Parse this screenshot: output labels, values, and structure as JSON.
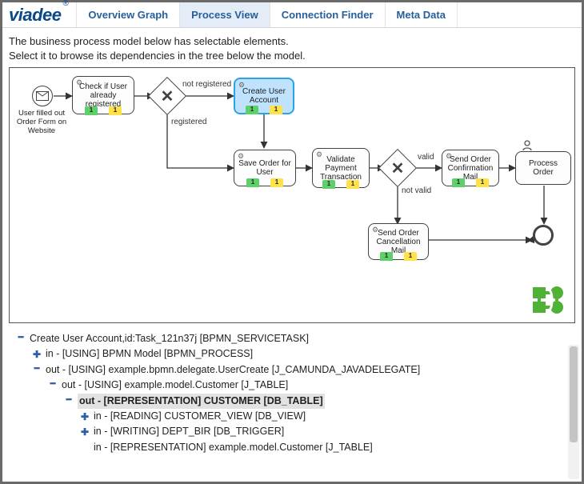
{
  "brand": "viadee",
  "brand_mark": "®",
  "tabs": {
    "overview": "Overview Graph",
    "process": "Process View",
    "connection": "Connection Finder",
    "meta": "Meta Data"
  },
  "instructions": {
    "line1": "The business process model below has selectable elements.",
    "line2": "Select it to browse its dependencies in the tree below the model."
  },
  "diagram": {
    "start_label": "User filled out Order Form on Website",
    "tasks": {
      "check_user": "Check if User already registered",
      "create_account": "Create User Account",
      "save_order": "Save Order for User",
      "validate": "Validate Payment Transaction",
      "send_conf": "Send Order Confirmation Mail",
      "send_cancel": "Send Order Cancellation Mail",
      "process_order": "Process Order"
    },
    "edge_labels": {
      "not_registered": "not registered",
      "registered": "registered",
      "valid": "valid",
      "not_valid": "not valid"
    },
    "badge": "1"
  },
  "tree": {
    "n0": "Create User Account,id:Task_121n37j [BPMN_SERVICETASK]",
    "n1": "in - [USING] BPMN Model [BPMN_PROCESS]",
    "n2": "out - [USING] example.bpmn.delegate.UserCreate [J_CAMUNDA_JAVADELEGATE]",
    "n3": "out - [USING] example.model.Customer [J_TABLE]",
    "n4": "out - [REPRESENTATION] CUSTOMER [DB_TABLE]",
    "n5": "in - [READING] CUSTOMER_VIEW [DB_VIEW]",
    "n6": "in - [WRITING] DEPT_BIR [DB_TRIGGER]",
    "n7": "in - [REPRESENTATION] example.model.Customer [J_TABLE]"
  }
}
